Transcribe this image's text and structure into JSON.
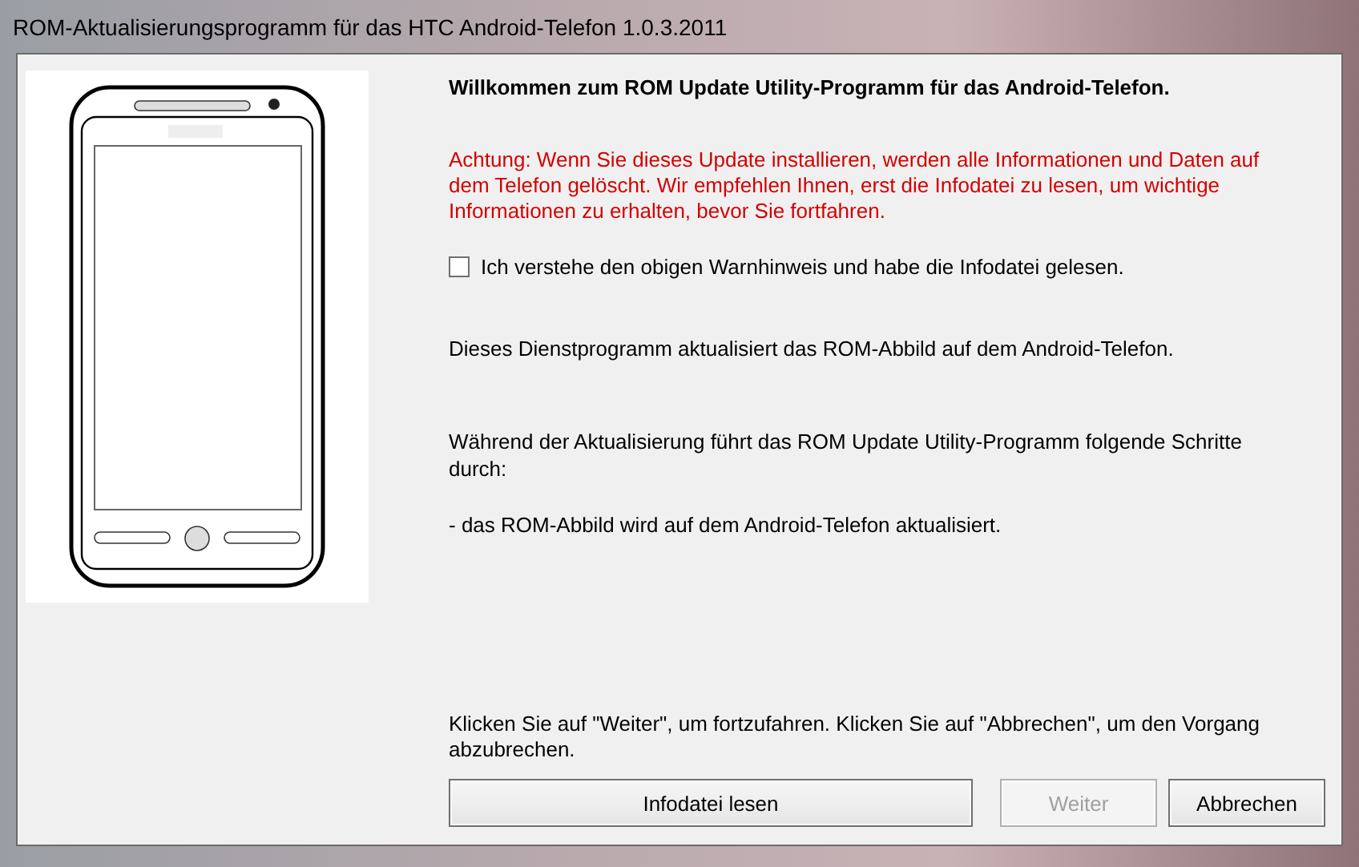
{
  "window": {
    "title": "ROM-Aktualisierungsprogramm für das HTC Android-Telefon 1.0.3.2011"
  },
  "heading": "Willkommen zum ROM Update Utility-Programm für das Android-Telefon.",
  "warning": "Achtung: Wenn Sie dieses Update installieren, werden alle Informationen und Daten auf dem Telefon gelöscht. Wir empfehlen Ihnen, erst die Infodatei zu lesen, um wichtige Informationen zu erhalten, bevor Sie fortfahren.",
  "agreement": {
    "label": "Ich verstehe den obigen Warnhinweis und habe die Infodatei gelesen.",
    "checked": false
  },
  "paragraphs": [
    "Dieses Dienstprogramm aktualisiert das ROM-Abbild auf dem Android-Telefon.",
    "Während der Aktualisierung führt das ROM Update Utility-Programm folgende Schritte durch:",
    "- das ROM-Abbild wird auf dem Android-Telefon aktualisiert."
  ],
  "footer_note": "Klicken Sie auf \"Weiter\", um fortzufahren. Klicken Sie auf \"Abbrechen\", um den Vorgang abzubrechen.",
  "buttons": [
    {
      "label": "Infodatei lesen",
      "disabled": false
    },
    {
      "label": "Weiter",
      "disabled": true
    },
    {
      "label": "Abbrechen",
      "disabled": false
    }
  ]
}
